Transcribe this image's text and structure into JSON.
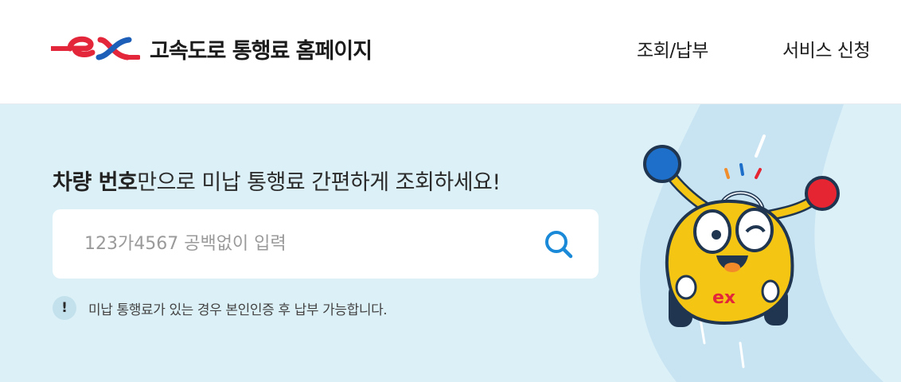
{
  "header": {
    "site_title": "고속도로 통행료 홈페이지",
    "logo_mark_text": "ex",
    "nav": [
      {
        "label": "조회/납부"
      },
      {
        "label": "서비스 신청"
      }
    ]
  },
  "hero": {
    "headline_bold": "차량 번호",
    "headline_rest": "만으로 미납 통행료 간편하게 조회하세요!",
    "search": {
      "placeholder": "123가4567 공백없이 입력",
      "value": ""
    },
    "notice_icon_text": "!",
    "notice": "미납 통행료가 있는 경우 본인인증 후 납부 가능합니다."
  },
  "colors": {
    "brand_red": "#e3263a",
    "brand_blue": "#1d5fb8",
    "hero_bg": "#dcf0f7",
    "search_icon": "#1a8ad8"
  },
  "icons": {
    "search": "search-icon",
    "notice": "exclamation-icon",
    "logo": "ex-logo-icon",
    "mascot": "car-mascot-illustration"
  }
}
